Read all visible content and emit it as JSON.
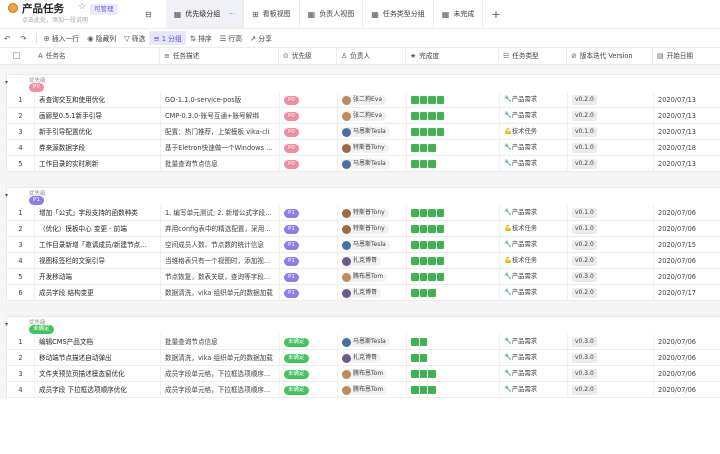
{
  "app": {
    "title": "产品任务",
    "permission": "可管理",
    "description": "点击此处，添加一段说明"
  },
  "tabs": [
    {
      "label": "优先级分组",
      "icon": "grid-icon",
      "active": true
    },
    {
      "label": "看板视图",
      "icon": "kanban-icon",
      "active": false
    },
    {
      "label": "负责人视图",
      "icon": "grid-icon",
      "active": false
    },
    {
      "label": "任务类型分组",
      "icon": "grid-icon",
      "active": false
    },
    {
      "label": "未完成",
      "icon": "grid-icon",
      "active": false
    }
  ],
  "toolbar": {
    "insert_row": "插入一行",
    "hide_cols": "隐藏列",
    "filter": "筛选",
    "group": "1 分组",
    "sort": "排序",
    "row_height": "行高",
    "share": "分享"
  },
  "columns": [
    "任务名",
    "任务描述",
    "优先级",
    "负责人",
    "完成度",
    "任务类型",
    "版本迭代 Version",
    "开始日期"
  ],
  "groups": [
    {
      "label": "优先级",
      "tag": "P0",
      "tag_class": "p0",
      "rows": [
        {
          "num": "1",
          "name": "表查询交互和使用优化",
          "desc": "GO-1.1.0-service-pos版",
          "priority": "P0",
          "person": "张二狗Eva",
          "av": "a",
          "progress": 0.8,
          "type_icon": "wrench-icon",
          "type": "产品需求",
          "version": "v0.2.0",
          "date": "2020/07/13"
        },
        {
          "num": "2",
          "name": "画廊型0.5.1新手引导",
          "desc": "CMP-0.3.0-账号互通+账号解绑",
          "priority": "P0",
          "person": "张二狗Eva",
          "av": "a",
          "progress": 0.8,
          "type_icon": "wrench-icon",
          "type": "产品需求",
          "version": "v0.2.0",
          "date": "2020/07/13"
        },
        {
          "num": "3",
          "name": "新手引导配置优化",
          "desc": "配置：热门推荐，上架模板 vika-cli",
          "priority": "P0",
          "person": "马恩斯Tesla",
          "av": "b",
          "progress": 0.8,
          "type_icon": "muscle-icon",
          "type": "技术任务",
          "version": "v0.1.0",
          "date": "2020/07/13"
        },
        {
          "num": "4",
          "name": "券来源数据字段",
          "desc": "基于Eletron快速做一个Windows ...",
          "priority": "P0",
          "person": "特斯普Tony",
          "av": "c",
          "progress": 0.6,
          "type_icon": "wrench-icon",
          "type": "产品需求",
          "version": "v0.1.0",
          "date": "2020/07/18"
        },
        {
          "num": "5",
          "name": "工作目录的实时刷新",
          "desc": "批量查询节点信息",
          "priority": "P0",
          "person": "马恩斯Tesla",
          "av": "b",
          "progress": 0.6,
          "type_icon": "wrench-icon",
          "type": "产品需求",
          "version": "v0.2.0",
          "date": "2020/07/13"
        }
      ]
    },
    {
      "label": "优先级",
      "tag": "P1",
      "tag_class": "p1",
      "rows": [
        {
          "num": "1",
          "name": "增加「公式」字段支持的函数种类",
          "desc": "1. 编写单元测试; 2. 新增公式字段...",
          "priority": "P1",
          "person": "特斯普Tony",
          "av": "c",
          "progress": 0.8,
          "type_icon": "wrench-icon",
          "type": "产品需求",
          "version": "v0.1.0",
          "date": "2020/07/06"
        },
        {
          "num": "2",
          "name": "（优化）模板中心 变更 - 前端",
          "desc": "弃用config表中的精选配置，采用...",
          "priority": "P1",
          "person": "特斯普Tony",
          "av": "c",
          "progress": 0.8,
          "type_icon": "muscle-icon",
          "type": "技术任务",
          "version": "v0.1.0",
          "date": "2020/07/06"
        },
        {
          "num": "3",
          "name": "工作目录新增「邀请成员/新建节点...",
          "desc": "空间成员人数、节点数的统计信息",
          "priority": "P1",
          "person": "马恩斯Tesla",
          "av": "b",
          "progress": 0.8,
          "type_icon": "wrench-icon",
          "type": "产品需求",
          "version": "v0.2.0",
          "date": "2020/07/15"
        },
        {
          "num": "4",
          "name": "视图标签栏的文案引导",
          "desc": "当维格表只有一个视图时，添加视...",
          "priority": "P1",
          "person": "扎克博哥",
          "av": "d",
          "progress": 0.8,
          "type_icon": "muscle-icon",
          "type": "技术任务",
          "version": "v0.2.0",
          "date": "2020/07/06"
        },
        {
          "num": "5",
          "name": "开发移动端",
          "desc": "节点恢复，数表关联，查询等字段...",
          "priority": "P1",
          "person": "腾布恩Tom",
          "av": "a",
          "progress": 0.8,
          "type_icon": "wrench-icon",
          "type": "产品需求",
          "version": "v0.3.0",
          "date": "2020/07/06"
        },
        {
          "num": "6",
          "name": "成员字段 结构变更",
          "desc": "数据清洗，vika 组织单元的数据加载",
          "priority": "P1",
          "person": "扎克博哥",
          "av": "d",
          "progress": 0.6,
          "type_icon": "wrench-icon",
          "type": "产品需求",
          "version": "v0.2.0",
          "date": "2020/07/17"
        }
      ]
    },
    {
      "label": "优先级",
      "tag": "未确定",
      "tag_class": "pu",
      "rows": [
        {
          "num": "1",
          "name": "编辑CMS产品文档",
          "desc": "批量查询节点信息",
          "priority": "未确定",
          "person": "马恩斯Tesla",
          "av": "b",
          "progress": 0.4,
          "type_icon": "wrench-icon",
          "type": "产品需求",
          "version": "v0.3.0",
          "date": "2020/07/06"
        },
        {
          "num": "2",
          "name": "移动端节点描述自动弹出",
          "desc": "数据清洗，vika 组织单元的数据加载",
          "priority": "未确定",
          "person": "扎克博哥",
          "av": "d",
          "progress": 0.4,
          "type_icon": "wrench-icon",
          "type": "产品需求",
          "version": "v0.3.0",
          "date": "2020/07/06"
        },
        {
          "num": "3",
          "name": "文件夹预览页描述模态窗优化",
          "desc": "成员字段单元格，下拉框选项顺序...",
          "priority": "未确定",
          "person": "腾布恩Tom",
          "av": "a",
          "progress": 0.6,
          "type_icon": "wrench-icon",
          "type": "产品需求",
          "version": "v0.3.0",
          "date": "2020/07/06"
        },
        {
          "num": "4",
          "name": "成员字段 下拉框选项顺序优化",
          "desc": "成员字段单元格，下拉框选项顺序...",
          "priority": "未确定",
          "person": "腾布恩Tom",
          "av": "a",
          "progress": 0.6,
          "type_icon": "wrench-icon",
          "type": "产品需求",
          "version": "v0.2.0",
          "date": "2020/07/06"
        }
      ]
    }
  ]
}
